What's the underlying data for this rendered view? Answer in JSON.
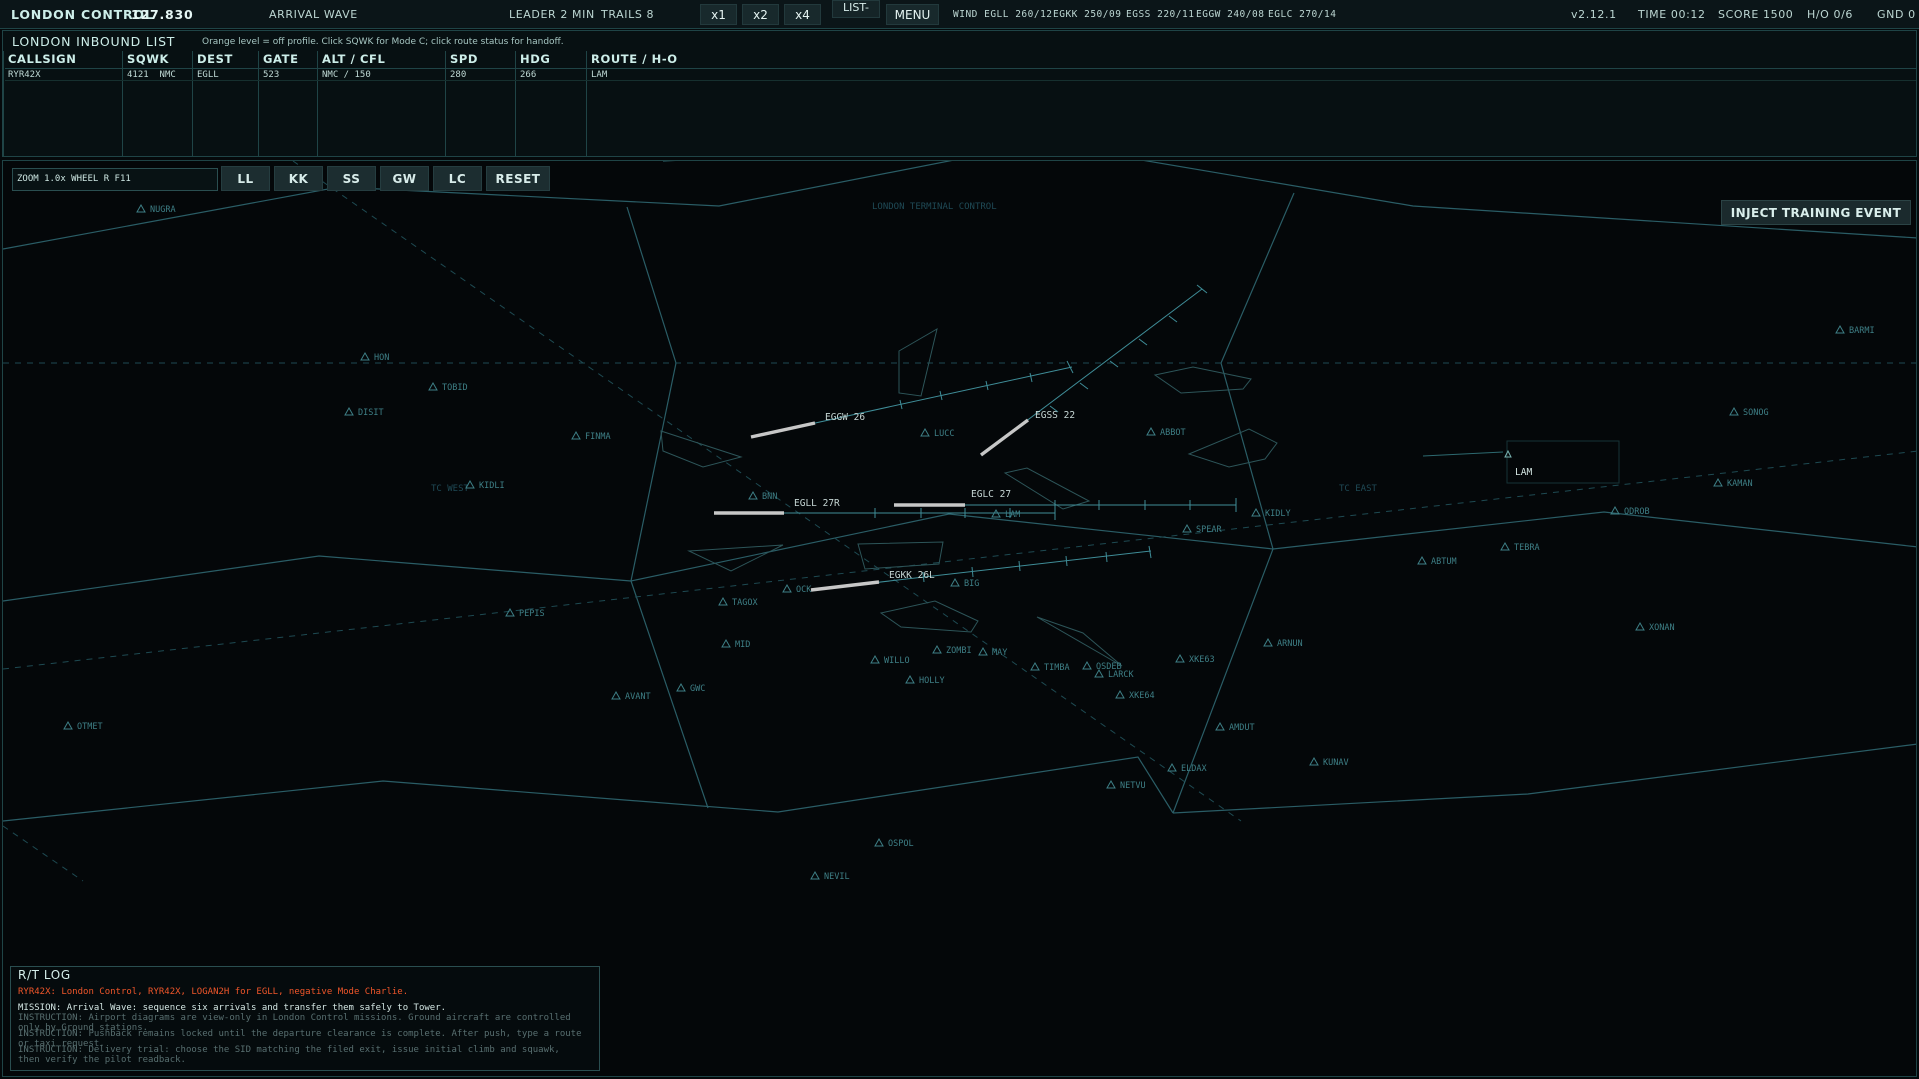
{
  "topbar": {
    "title": "LONDON CONTROL",
    "frequency": "127.830",
    "mission": "ARRIVAL WAVE",
    "leader": "LEADER 2 MIN",
    "trails": "TRAILS 8",
    "speed_buttons": [
      "x1",
      "x2",
      "x4"
    ],
    "list_label": "LIST-",
    "menu_label": "MENU",
    "wind": [
      "WIND EGLL 260/12",
      "EGKK 250/09",
      "EGSS 220/11",
      "EGGW 240/08",
      "EGLC 270/14"
    ],
    "version": "v2.12.1",
    "time": "TIME 00:12",
    "score": "SCORE 1500",
    "handoffs": "H/O 0/6",
    "ground": "GND 0"
  },
  "inbound": {
    "title": "LONDON INBOUND LIST",
    "hint": "Orange level = off profile. Click SQWK for Mode C; click route status for handoff.",
    "columns": [
      "CALLSIGN",
      "SQWK",
      "DEST",
      "GATE",
      "ALT / CFL",
      "SPD",
      "HDG",
      "ROUTE / H-O"
    ],
    "rows": [
      {
        "callsign": "RYR42X",
        "squawk": "4121",
        "squawk_flag": "NMC",
        "dest": "EGLL",
        "gate": "523",
        "alt_cfl": "NMC / 150",
        "spd": "280",
        "hdg": "266",
        "route": "LAM"
      }
    ]
  },
  "radar": {
    "zoom_readout": "ZOOM 1.0x  WHEEL  R  F11",
    "view_buttons": [
      "LL",
      "KK",
      "SS",
      "GW",
      "LC"
    ],
    "reset_label": "RESET",
    "inject_label": "INJECT TRAINING EVENT",
    "sector_labels": [
      "LONDON TERMINAL CONTROL",
      "TC WEST",
      "TC EAST"
    ],
    "runways": [
      "EGGW 26",
      "EGSS 22",
      "EGLL 27R",
      "EGLC 27",
      "EGKK 26L"
    ],
    "aircraft_tag": "LAM",
    "fixes": [
      "NUGRA",
      "HON",
      "TOBID",
      "DISIT",
      "FINMA",
      "KIDLI",
      "BNN",
      "LUCC",
      "ABBOT",
      "LAM",
      "KIDLY",
      "SPEAR",
      "ABTUM",
      "TEBRA",
      "ODROB",
      "BIG",
      "OCK",
      "TAGOX",
      "PEPIS",
      "MID",
      "WILLO",
      "ZOMBI",
      "MAY",
      "TIMBA",
      "OSDEB",
      "LARCK",
      "XKE63",
      "XKE64",
      "HOLLY",
      "GWC",
      "AVANT",
      "OTMET",
      "ARNUN",
      "AMDUT",
      "KUNAV",
      "ELDAX",
      "NETVU",
      "OSPOL",
      "NEVIL",
      "BARMI",
      "SONOG",
      "KAMAN",
      "XONAN"
    ],
    "colors": {
      "sector": "#2a5d66",
      "fix": "#3e7f86",
      "runway": "#c7c7c7",
      "centerline": "#3f8d98"
    }
  },
  "rt_log": {
    "title": "R/T LOG",
    "lines": [
      "RYR42X: London Control, RYR42X, LOGAN2H for EGLL, negative Mode Charlie.",
      "MISSION: Arrival Wave: sequence six arrivals and transfer them safely to Tower.",
      "INSTRUCTION: Airport diagrams are view-only in London Control missions. Ground aircraft are controlled",
      "only by Ground stations.",
      "INSTRUCTION: Pushback remains locked until the departure clearance is complete. After push, type a route",
      "or taxi request.",
      "INSTRUCTION: Delivery trial: choose the SID matching the filed exit, issue initial climb and squawk,",
      "then verify the pilot readback."
    ]
  }
}
